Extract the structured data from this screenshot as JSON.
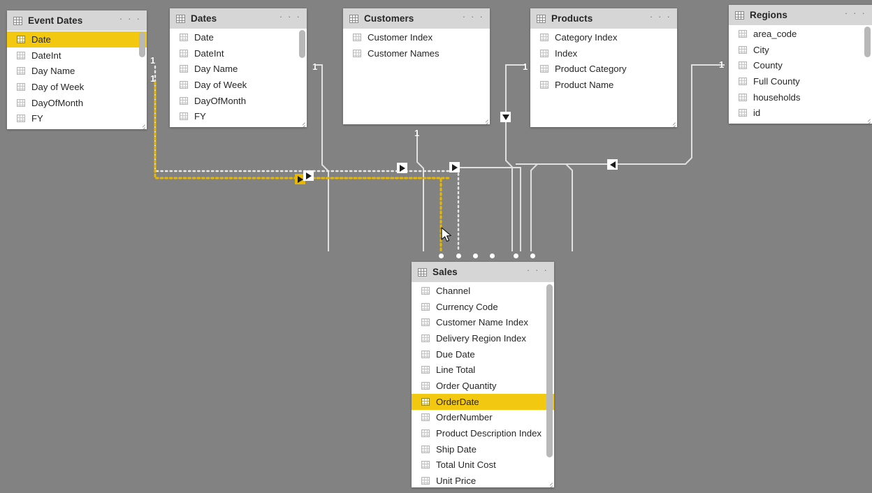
{
  "app": {
    "view_name": "model-view",
    "canvas_background": "#828282"
  },
  "colors": {
    "highlight": "#f2c811",
    "relationship_line": "#e0e0e0",
    "selected_relationship_line": "#e8b800",
    "card_header": "#d6d6d6",
    "card_body": "#ffffff"
  },
  "tables": [
    {
      "id": "event-dates",
      "title": "Event Dates",
      "ellipsis": "· · ·",
      "fields": [
        {
          "name": "Date",
          "selected": true
        },
        {
          "name": "DateInt",
          "selected": false
        },
        {
          "name": "Day Name",
          "selected": false
        },
        {
          "name": "Day of Week",
          "selected": false
        },
        {
          "name": "DayOfMonth",
          "selected": false
        },
        {
          "name": "FY",
          "selected": false
        }
      ],
      "has_scrollbar": true
    },
    {
      "id": "dates",
      "title": "Dates",
      "ellipsis": "· · ·",
      "fields": [
        {
          "name": "Date",
          "selected": false
        },
        {
          "name": "DateInt",
          "selected": false
        },
        {
          "name": "Day Name",
          "selected": false
        },
        {
          "name": "Day of Week",
          "selected": false
        },
        {
          "name": "DayOfMonth",
          "selected": false
        },
        {
          "name": "FY",
          "selected": false
        }
      ],
      "has_scrollbar": true
    },
    {
      "id": "customers",
      "title": "Customers",
      "ellipsis": "· · ·",
      "fields": [
        {
          "name": "Customer Index",
          "selected": false
        },
        {
          "name": "Customer Names",
          "selected": false
        }
      ],
      "has_scrollbar": false
    },
    {
      "id": "products",
      "title": "Products",
      "ellipsis": "· · ·",
      "fields": [
        {
          "name": "Category Index",
          "selected": false
        },
        {
          "name": "Index",
          "selected": false
        },
        {
          "name": "Product Category",
          "selected": false
        },
        {
          "name": "Product Name",
          "selected": false
        }
      ],
      "has_scrollbar": false
    },
    {
      "id": "regions",
      "title": "Regions",
      "ellipsis": "· · ·",
      "fields": [
        {
          "name": "area_code",
          "selected": false
        },
        {
          "name": "City",
          "selected": false
        },
        {
          "name": "County",
          "selected": false
        },
        {
          "name": "Full County",
          "selected": false
        },
        {
          "name": "households",
          "selected": false
        },
        {
          "name": "id",
          "selected": false
        }
      ],
      "has_scrollbar": true
    },
    {
      "id": "sales",
      "title": "Sales",
      "ellipsis": "· · ·",
      "fields": [
        {
          "name": "Channel",
          "selected": false
        },
        {
          "name": "Currency Code",
          "selected": false
        },
        {
          "name": "Customer Name Index",
          "selected": false
        },
        {
          "name": "Delivery Region Index",
          "selected": false
        },
        {
          "name": "Due Date",
          "selected": false
        },
        {
          "name": "Line Total",
          "selected": false
        },
        {
          "name": "Order Quantity",
          "selected": false
        },
        {
          "name": "OrderDate",
          "selected": true
        },
        {
          "name": "OrderNumber",
          "selected": false
        },
        {
          "name": "Product Description Index",
          "selected": false
        },
        {
          "name": "Ship Date",
          "selected": false
        },
        {
          "name": "Total Unit Cost",
          "selected": false
        },
        {
          "name": "Unit Price",
          "selected": false
        }
      ],
      "has_scrollbar": true
    }
  ],
  "relationship_cardinality_labels": [
    {
      "id": "event-dates-one",
      "value": "1"
    },
    {
      "id": "dates-one-a",
      "value": "1"
    },
    {
      "id": "dates-one-b",
      "value": "1"
    },
    {
      "id": "customers-one",
      "value": "1"
    },
    {
      "id": "sales-one",
      "value": "1"
    },
    {
      "id": "products-one",
      "value": "1"
    },
    {
      "id": "regions-one",
      "value": "1"
    }
  ]
}
